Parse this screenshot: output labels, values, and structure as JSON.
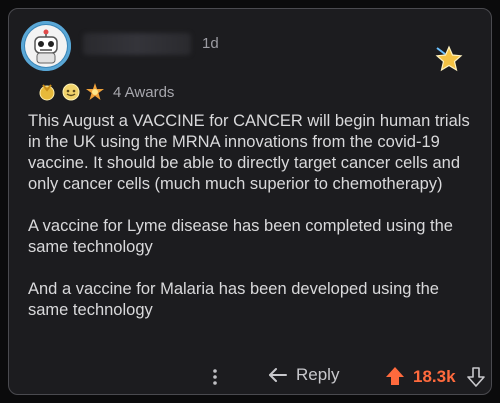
{
  "comment": {
    "time": "1d",
    "awards_label": "4 Awards",
    "paragraphs": [
      "This August a VACCINE for CANCER will begin human trials in the UK using the MRNA innovations from the covid-19 vaccine. It should be able to directly target cancer cells and only cancer cells (much much superior to chemotherapy)",
      "A vaccine for Lyme disease has been completed using the same technology",
      "And a vaccine for Malaria has been developed using the same technology"
    ]
  },
  "footer": {
    "reply_label": "Reply",
    "score": "18.3k"
  },
  "colors": {
    "background": "#1c1c1f",
    "text": "#d9d9db",
    "upvote_accent": "#ff6a3d",
    "muted": "#9c9ca3"
  },
  "icons": {
    "avatar": "robot-avatar",
    "star_badge": "star-badge-icon",
    "awards": [
      "gold-medal-icon",
      "helpful-face-icon",
      "starburst-icon"
    ],
    "more": "more-dots-icon",
    "reply": "reply-arrow-icon",
    "upvote": "upvote-arrow-icon",
    "downvote": "downvote-arrow-icon"
  }
}
